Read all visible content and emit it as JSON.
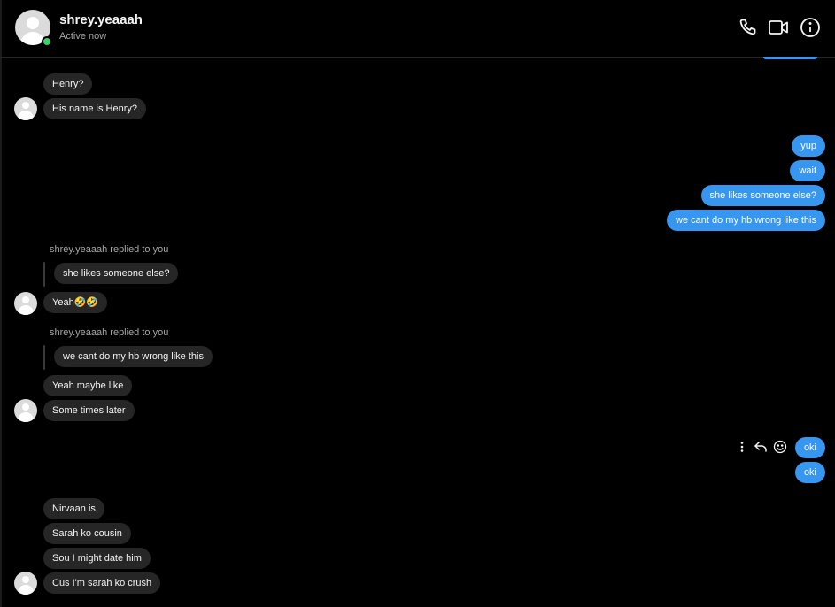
{
  "header": {
    "name": "shrey.yeaaah",
    "status": "Active now",
    "icons": [
      "phone-icon",
      "video-camera-icon",
      "info-icon"
    ]
  },
  "colors": {
    "background": "#000000",
    "incoming_bubble": "#262626",
    "outgoing_bubble": "#3797f0",
    "online": "#3dd068",
    "muted_text": "#a8a8a8"
  },
  "messages": {
    "m1": "Henry?",
    "m2": "His name is Henry?",
    "m3": "yup",
    "m4": "wait",
    "m5": "she likes someone else?",
    "m6": "we cant do my hb wrong like this",
    "reply1_note": "shrey.yeaaah replied to you",
    "reply1_quote": "she likes someone else?",
    "m7": "Yeah🤣🤣",
    "reply2_note": "shrey.yeaaah replied to you",
    "reply2_quote": "we cant do my hb wrong like this",
    "m8": "Yeah maybe like",
    "m9": "Some times later",
    "m10": "oki",
    "m11": "oki",
    "m12": "Nirvaan is",
    "m13": "Sarah ko cousin",
    "m14": "Sou I might date him",
    "m15": "Cus I'm sarah ko crush"
  },
  "message_actions": [
    "more-options-icon",
    "reply-icon",
    "react-emoji-icon"
  ]
}
